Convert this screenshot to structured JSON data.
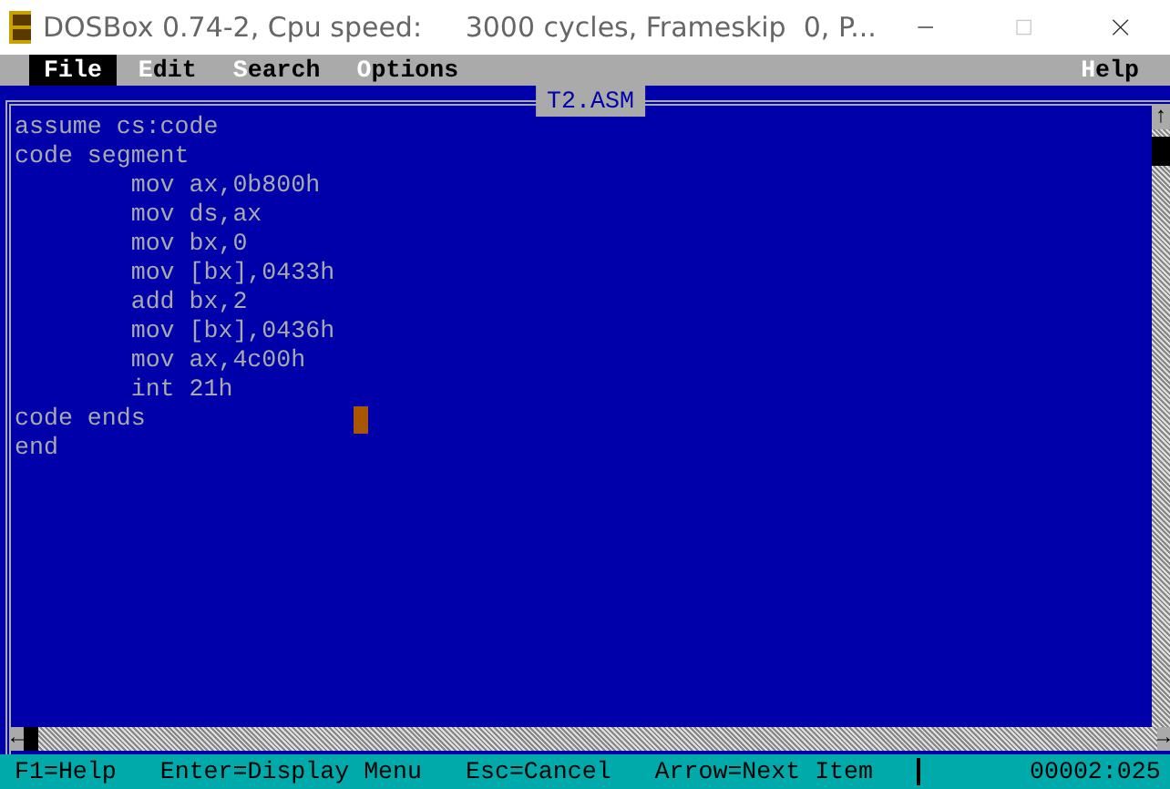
{
  "window": {
    "title": "DOSBox 0.74-2, Cpu speed:     3000 cycles, Frameskip  0, P..."
  },
  "menu": [
    {
      "label": "File",
      "selected": true
    },
    {
      "label": "Edit",
      "selected": false
    },
    {
      "label": "Search",
      "selected": false
    },
    {
      "label": "Options",
      "selected": false
    },
    {
      "label": "Help",
      "selected": false
    }
  ],
  "editor": {
    "title": "T2.ASM",
    "lines": [
      "assume cs:code",
      "code segment",
      "        mov ax,0b800h",
      "        mov ds,ax",
      "        mov bx,0",
      "        mov [bx],0433h",
      "        add bx,2",
      "        mov [bx],0436h",
      "        mov ax,4c00h",
      "        int 21h",
      "code ends",
      "end"
    ],
    "scroll_up": "↑",
    "scroll_left": "←",
    "scroll_right": "→"
  },
  "status_bar": {
    "hints": [
      "F1=Help",
      "Enter=Display Menu",
      "Esc=Cancel",
      "Arrow=Next Item"
    ],
    "position": "00002:025"
  }
}
